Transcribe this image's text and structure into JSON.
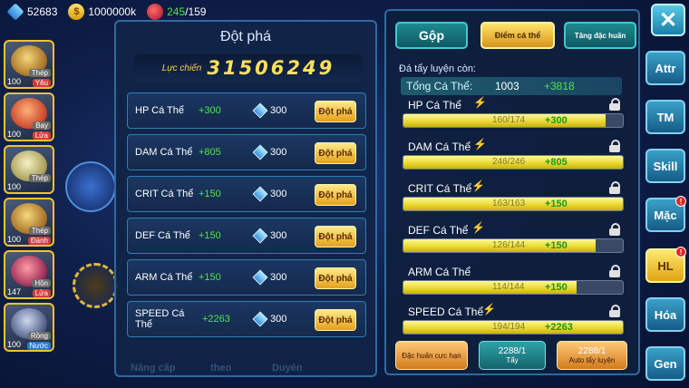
{
  "topbar": {
    "gems": "52683",
    "coins": "1000000k",
    "potion_current": "245",
    "potion_max": "/159"
  },
  "pets": [
    {
      "level": "100",
      "tag1": "Thép",
      "tag2": "Yêu"
    },
    {
      "level": "100",
      "tag1": "Bay",
      "tag2": "Lửa"
    },
    {
      "level": "100",
      "tag1": "Thép",
      "tag2": ""
    },
    {
      "level": "100",
      "tag1": "Thép",
      "tag2": "Đánh"
    },
    {
      "level": "147",
      "tag1": "Hồn",
      "tag2": "Lửa"
    },
    {
      "level": "100",
      "tag1": "Rồng",
      "tag2": "Nước"
    }
  ],
  "left_panel": {
    "title": "Đột phá",
    "power_label": "Lực chiến",
    "power_value": "31506249",
    "rows": [
      {
        "name": "HP Cá Thể",
        "bonus": "+300",
        "cost": "300",
        "button": "Đột phá"
      },
      {
        "name": "DAM Cá Thể",
        "bonus": "+805",
        "cost": "300",
        "button": "Đột phá"
      },
      {
        "name": "CRIT Cá Thể",
        "bonus": "+150",
        "cost": "300",
        "button": "Đột phá"
      },
      {
        "name": "DEF Cá Thể",
        "bonus": "+150",
        "cost": "300",
        "button": "Đột phá"
      },
      {
        "name": "ARM Cá Thể",
        "bonus": "+150",
        "cost": "300",
        "button": "Đột phá"
      },
      {
        "name": "SPEED Cá Thể",
        "bonus": "+2263",
        "cost": "300",
        "button": "Đột phá"
      }
    ]
  },
  "right_panel": {
    "tab_merge": "Gộp",
    "tab_individual": "Điểm cá thể",
    "tab_special": "Tăng đặc huấn",
    "remaining_label": "Đá tẩy luyện còn:",
    "total_label": "Tổng Cá Thể:",
    "total_value": "1003",
    "total_bonus": "+3818",
    "stats": [
      {
        "name": "HP Cá Thể",
        "value": "160/174",
        "bonus": "+300",
        "fill": 0.92
      },
      {
        "name": "DAM Cá Thể",
        "value": "246/246",
        "bonus": "+805",
        "fill": 1.0
      },
      {
        "name": "CRIT Cá Thể",
        "value": "163/163",
        "bonus": "+150",
        "fill": 1.0
      },
      {
        "name": "DEF Cá Thể",
        "value": "126/144",
        "bonus": "+150",
        "fill": 0.875
      },
      {
        "name": "ARM Cá Thể",
        "value": "114/144",
        "bonus": "+150",
        "fill": 0.79
      },
      {
        "name": "SPEED Cá Thể",
        "value": "194/194",
        "bonus": "+2263",
        "fill": 1.0
      }
    ],
    "btn_limit": "Đặc huấn cực hạn",
    "btn_wash_count": "2288/1",
    "btn_wash": "Tẩy",
    "btn_auto_count": "2288/1",
    "btn_auto": "Auto tẩy luyện"
  },
  "side_nav": {
    "close": "✕",
    "items": [
      "Attr",
      "TM",
      "Skill",
      "Mặc",
      "HL",
      "Hóa",
      "Gen"
    ]
  },
  "bottom": {
    "upgrade": "Nâng cấp",
    "follow": "theo",
    "fate": "Duyên"
  }
}
